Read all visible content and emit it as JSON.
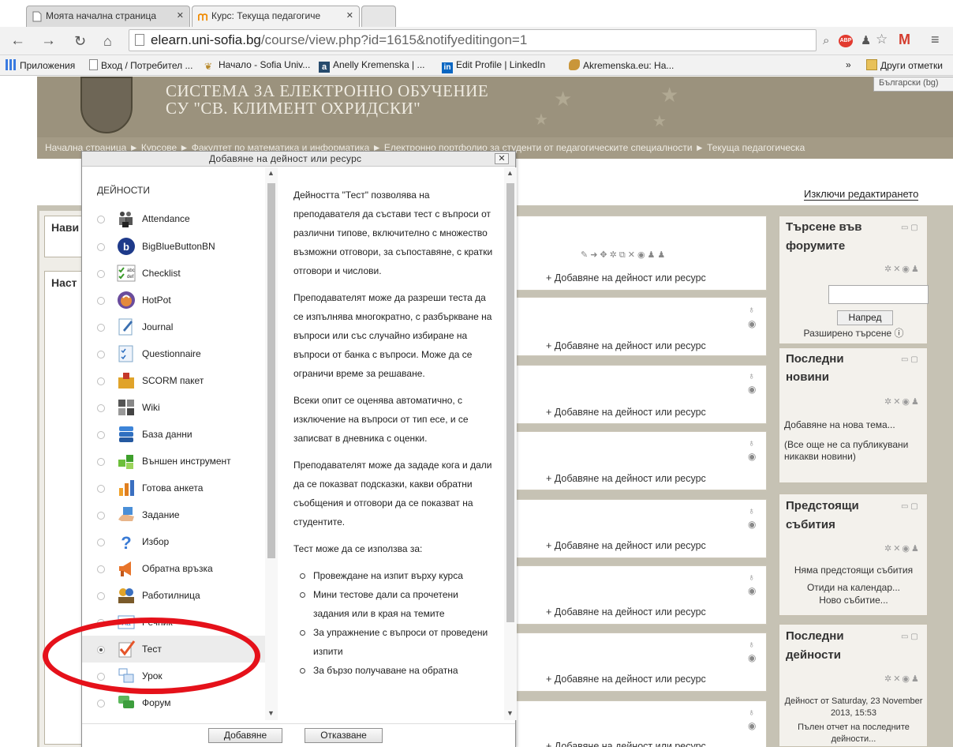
{
  "browser": {
    "tabs": [
      {
        "title": "Моята начална страница",
        "active": false
      },
      {
        "title": "Курс: Текуща педагогиче",
        "active": true
      }
    ],
    "url_host": "elearn.uni-sofia.bg",
    "url_path": "/course/view.php?id=1615&notifyeditingon=1",
    "bookmarks": [
      {
        "label": "Приложения",
        "icon": "apps-grid-icon"
      },
      {
        "label": "Вход / Потребител ...",
        "icon": "page-icon"
      },
      {
        "label": "Начало - Sofia Univ...",
        "icon": "pin-icon"
      },
      {
        "label": "Anelly Kremenska | ...",
        "icon": "a-logo-icon"
      },
      {
        "label": "Edit Profile | LinkedIn",
        "icon": "linkedin-icon"
      },
      {
        "label": "Akremenska.eu: Ha...",
        "icon": "bird-icon"
      },
      {
        "label": "»",
        "icon": ""
      },
      {
        "label": "Други отметки",
        "icon": "folder-icon"
      }
    ]
  },
  "site": {
    "title_line1": "СИСТЕМА ЗА ЕЛЕКТРОННО ОБУЧЕНИЕ",
    "title_line2": "СУ \"СВ. КЛИМЕНТ ОХРИДСКИ\"",
    "language": "Български (bg)",
    "breadcrumb": "Начална страница ► Курсове ► Факултет по математика и информатика ► Електронно портфолио за студенти от педагогическите специалности ► Текуща педагогическа",
    "edit_toggle": "Изключи редактирането"
  },
  "left_blocks": {
    "nav_title": "Нави",
    "settings_title": "Наст"
  },
  "sections": {
    "add_activity_label": "+ Добавяне на дейност или ресурс"
  },
  "right_blocks": {
    "search": {
      "title_line1": "Търсене във",
      "title_line2": "форумите",
      "button": "Напред",
      "advanced": "Разширено търсене ⓘ"
    },
    "news": {
      "title_line1": "Последни",
      "title_line2": "новини",
      "add_topic": "Добавяне на нова тема...",
      "empty": "(Все още не са публикувани никакви новини)"
    },
    "events": {
      "title_line1": "Предстоящи",
      "title_line2": "събития",
      "none": "Няма предстоящи събития",
      "goto_calendar": "Отиди на календар...",
      "new_event": "Ново събитие..."
    },
    "activity": {
      "title_line1": "Последни",
      "title_line2": "дейности",
      "since": "Дейност от Saturday, 23 November 2013, 15:53",
      "full_report": "Пълен отчет на последните дейности..."
    }
  },
  "modal": {
    "title": "Добавяне на дейност или ресурс",
    "list_header": "ДЕЙНОСТИ",
    "options": [
      {
        "label": "Attendance",
        "icon": "people-icon",
        "selected": false
      },
      {
        "label": "BigBlueButtonBN",
        "icon": "bigbluebutton-icon",
        "selected": false
      },
      {
        "label": "Checklist",
        "icon": "checklist-icon",
        "selected": false
      },
      {
        "label": "HotPot",
        "icon": "hotpot-icon",
        "selected": false
      },
      {
        "label": "Journal",
        "icon": "journal-icon",
        "selected": false
      },
      {
        "label": "Questionnaire",
        "icon": "questionnaire-icon",
        "selected": false
      },
      {
        "label": "SCORM пакет",
        "icon": "scorm-icon",
        "selected": false
      },
      {
        "label": "Wiki",
        "icon": "wiki-icon",
        "selected": false
      },
      {
        "label": "База данни",
        "icon": "database-icon",
        "selected": false
      },
      {
        "label": "Външен инструмент",
        "icon": "puzzle-icon",
        "selected": false
      },
      {
        "label": "Готова анкета",
        "icon": "survey-chart-icon",
        "selected": false
      },
      {
        "label": "Задание",
        "icon": "assignment-hand-icon",
        "selected": false
      },
      {
        "label": "Избор",
        "icon": "question-mark-icon",
        "selected": false
      },
      {
        "label": "Обратна връзка",
        "icon": "megaphone-icon",
        "selected": false
      },
      {
        "label": "Работилница",
        "icon": "workshop-icon",
        "selected": false
      },
      {
        "label": "Речник",
        "icon": "glossary-icon",
        "selected": false
      },
      {
        "label": "Тест",
        "icon": "quiz-check-icon",
        "selected": true
      },
      {
        "label": "Урок",
        "icon": "lesson-icon",
        "selected": false
      },
      {
        "label": "Форум",
        "icon": "forum-icon",
        "selected": false
      }
    ],
    "description": {
      "p1": "Дейността \"Тест\" позволява на преподавателя да състави тест с въпроси от различни типове, включително с множество възможни отговори, за съпоставяне, с кратки отговори и числови.",
      "p2": "Преподавателят може да разреши теста да се изпълнява многократно, с разбъркване на въпроси или със случайно избиране на въпроси от банка с въпроси. Може да се ограничи време за решаване.",
      "p3": "Всеки опит се оценява автоматично, с изключение на въпроси от тип есе, и се записват в дневника с оценки.",
      "p4": "Преподавателят може да зададе кога и дали да се показват подсказки, какви обратни съобщения и отговори да се показват на студентите.",
      "p5": "Тест може да се използва за:",
      "uses": [
        "Провеждане на изпит върху курса",
        "Мини тестове дали са прочетени задания или в края на темите",
        "За упражнение с въпроси от проведени изпити",
        "За бързо получаване на обратна"
      ]
    },
    "add_button": "Добавяне",
    "cancel_button": "Отказване"
  },
  "colors": {
    "header_bg": "#9b927d",
    "content_bg": "#c6c2b4",
    "annotation_ring": "#e5111a"
  }
}
